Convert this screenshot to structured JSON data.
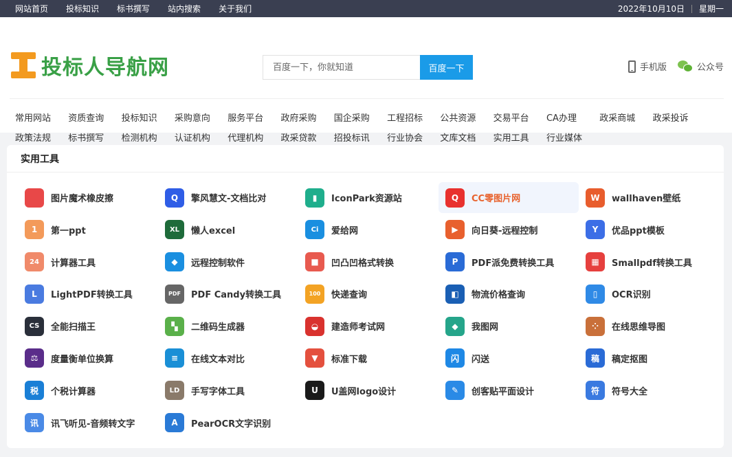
{
  "topbar": {
    "links": [
      "网站首页",
      "投标知识",
      "标书撰写",
      "站内搜索",
      "关于我们"
    ],
    "date": "2022年10月10日",
    "weekday": "星期一"
  },
  "header": {
    "logo_text": "投标人导航网",
    "search_placeholder": "百度一下，你就知道",
    "search_button": "百度一下",
    "mobile_label": "手机版",
    "wechat_label": "公众号"
  },
  "catnav": {
    "row1": [
      "常用网站",
      "资质查询",
      "投标知识",
      "采购意向",
      "服务平台",
      "政府采购",
      "国企采购",
      "工程招标",
      "公共资源",
      "交易平台",
      "CA办理",
      "政采商城",
      "政采投诉"
    ],
    "row2": [
      "政策法规",
      "标书撰写",
      "检测机构",
      "认证机构",
      "代理机构",
      "政采贷款",
      "招投标讯",
      "行业协会",
      "文库文档",
      "实用工具",
      "行业媒体"
    ]
  },
  "panel": {
    "title": "实用工具",
    "tools": [
      {
        "name": "图片魔术橡皮擦",
        "icon": "blob-icon",
        "color": "#e84848",
        "glyph": ""
      },
      {
        "name": "擎风慧文-文档比对",
        "icon": "search-doc-icon",
        "color": "#2f5de6",
        "glyph": "Q"
      },
      {
        "name": "IconPark资源站",
        "icon": "iconpark-icon",
        "color": "#1fae8c",
        "glyph": "▮"
      },
      {
        "name": "CC零图片网",
        "icon": "cc0-icon",
        "color": "#e8312e",
        "glyph": "Q"
      },
      {
        "name": "wallhaven壁纸",
        "icon": "wallhaven-icon",
        "color": "#e85d2d",
        "glyph": "W"
      },
      {
        "name": "第一ppt",
        "icon": "number-one-icon",
        "color": "#f39a5a",
        "glyph": "1"
      },
      {
        "name": "懒人excel",
        "icon": "excel-icon",
        "color": "#1e6b3a",
        "glyph": "XL"
      },
      {
        "name": "爱给网",
        "icon": "aigei-icon",
        "color": "#1a8fe0",
        "glyph": "Ci"
      },
      {
        "name": "向日葵-远程控制",
        "icon": "sunflower-icon",
        "color": "#e8602e",
        "glyph": "▶"
      },
      {
        "name": "优品ppt模板",
        "icon": "youpin-icon",
        "color": "#3c6ee6",
        "glyph": "Y"
      },
      {
        "name": "计算器工具",
        "icon": "calculator-icon",
        "color": "#f08a6a",
        "glyph": "24"
      },
      {
        "name": "远程控制软件",
        "icon": "remote-icon",
        "color": "#1a8fe0",
        "glyph": "◆"
      },
      {
        "name": "凹凸凹格式转换",
        "icon": "cube-icon",
        "color": "#e85a4f",
        "glyph": "■"
      },
      {
        "name": "PDF派免费转换工具",
        "icon": "pdfpai-icon",
        "color": "#2a6bd6",
        "glyph": "P"
      },
      {
        "name": "Smallpdf转换工具",
        "icon": "smallpdf-icon",
        "color": "#e6403e",
        "glyph": "▦"
      },
      {
        "name": "LightPDF转换工具",
        "icon": "lightpdf-icon",
        "color": "#4a7be0",
        "glyph": "L"
      },
      {
        "name": "PDF Candy转换工具",
        "icon": "pdfcandy-icon",
        "color": "#666666",
        "glyph": "PDF"
      },
      {
        "name": "快递查询",
        "icon": "express-icon",
        "color": "#f3a324",
        "glyph": "100"
      },
      {
        "name": "物流价格查询",
        "icon": "logistics-icon",
        "color": "#1a5fb4",
        "glyph": "◧"
      },
      {
        "name": "OCR识别",
        "icon": "ocr-icon",
        "color": "#2f8ae6",
        "glyph": "▯"
      },
      {
        "name": "全能扫描王",
        "icon": "camscanner-icon",
        "color": "#2a2f3a",
        "glyph": "CS"
      },
      {
        "name": "二维码生成器",
        "icon": "qrcode-icon",
        "color": "#5ab04a",
        "glyph": "▚"
      },
      {
        "name": "建造师考试网",
        "icon": "builder-icon",
        "color": "#d9322e",
        "glyph": "◒"
      },
      {
        "name": "我图网",
        "icon": "ooopic-icon",
        "color": "#25a58a",
        "glyph": "◆"
      },
      {
        "name": "在线思维导图",
        "icon": "mindmap-icon",
        "color": "#c9703a",
        "glyph": "⁘"
      },
      {
        "name": "度量衡单位换算",
        "icon": "scale-icon",
        "color": "#5a2d8a",
        "glyph": "⚖"
      },
      {
        "name": "在线文本对比",
        "icon": "text-compare-icon",
        "color": "#1a8fd6",
        "glyph": "≡"
      },
      {
        "name": "标准下载",
        "icon": "standard-download-icon",
        "color": "#e4503e",
        "glyph": "▼"
      },
      {
        "name": "闪送",
        "icon": "shansong-icon",
        "color": "#1e88e5",
        "glyph": "闪"
      },
      {
        "name": "稿定抠图",
        "icon": "gaoding-icon",
        "color": "#2a6bd6",
        "glyph": "稿"
      },
      {
        "name": "个税计算器",
        "icon": "tax-icon",
        "color": "#1a7fd6",
        "glyph": "税"
      },
      {
        "name": "手写字体工具",
        "icon": "handwriting-icon",
        "color": "#8a7a6a",
        "glyph": "LD"
      },
      {
        "name": "U盖网logo设计",
        "icon": "ugai-icon",
        "color": "#1a1a1a",
        "glyph": "U"
      },
      {
        "name": "创客贴平面设计",
        "icon": "chuangkit-icon",
        "color": "#2a8ae6",
        "glyph": "✎"
      },
      {
        "name": "符号大全",
        "icon": "symbol-icon",
        "color": "#3a7ae0",
        "glyph": "符"
      },
      {
        "name": "讯飞听见-音频转文字",
        "icon": "iflytek-icon",
        "color": "#4a8ae6",
        "glyph": "讯"
      },
      {
        "name": "PearOCR文字识别",
        "icon": "pearocr-icon",
        "color": "#2a7ad6",
        "glyph": "A"
      }
    ]
  }
}
